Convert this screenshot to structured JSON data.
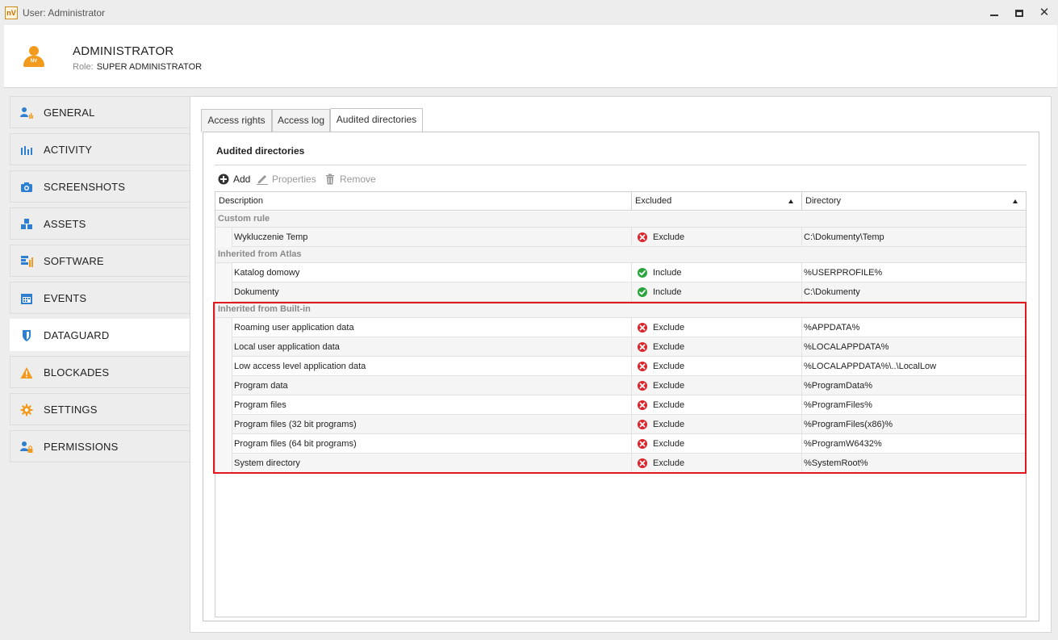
{
  "window": {
    "title": "User: Administrator",
    "app_icon_text": "nV"
  },
  "header": {
    "user_name": "ADMINISTRATOR",
    "role_label": "Role:",
    "role_value": "SUPER ADMINISTRATOR",
    "avatar_text": "NV"
  },
  "sidebar": {
    "items": [
      {
        "label": "GENERAL",
        "icon": "user-chart-icon"
      },
      {
        "label": "ACTIVITY",
        "icon": "bar-chart-icon"
      },
      {
        "label": "SCREENSHOTS",
        "icon": "camera-icon"
      },
      {
        "label": "ASSETS",
        "icon": "cubes-icon"
      },
      {
        "label": "SOFTWARE",
        "icon": "software-icon"
      },
      {
        "label": "EVENTS",
        "icon": "calendar-icon"
      },
      {
        "label": "DATAGUARD",
        "icon": "shield-icon",
        "active": true
      },
      {
        "label": "BLOCKADES",
        "icon": "warning-icon"
      },
      {
        "label": "SETTINGS",
        "icon": "gear-icon"
      },
      {
        "label": "PERMISSIONS",
        "icon": "user-lock-icon"
      }
    ]
  },
  "tabs": [
    {
      "label": "Access rights"
    },
    {
      "label": "Access log"
    },
    {
      "label": "Audited directories",
      "active": true
    }
  ],
  "panel": {
    "title": "Audited directories",
    "toolbar": {
      "add": "Add",
      "properties": "Properties",
      "remove": "Remove"
    },
    "columns": {
      "description": "Description",
      "excluded": "Excluded",
      "directory": "Directory"
    },
    "groups": [
      {
        "label": "Custom rule",
        "rows": [
          {
            "description": "Wykluczenie Temp",
            "status": "Exclude",
            "directory": "C:\\Dokumenty\\Temp"
          }
        ]
      },
      {
        "label": "Inherited from Atlas",
        "rows": [
          {
            "description": "Katalog domowy",
            "status": "Include",
            "directory": "%USERPROFILE%"
          },
          {
            "description": "Dokumenty",
            "status": "Include",
            "directory": "C:\\Dokumenty"
          }
        ]
      },
      {
        "label": "Inherited from Built-in",
        "rows": [
          {
            "description": "Roaming user application data",
            "status": "Exclude",
            "directory": "%APPDATA%"
          },
          {
            "description": "Local user application data",
            "status": "Exclude",
            "directory": "%LOCALAPPDATA%"
          },
          {
            "description": "Low access level application data",
            "status": "Exclude",
            "directory": "%LOCALAPPDATA%\\..\\LocalLow"
          },
          {
            "description": "Program data",
            "status": "Exclude",
            "directory": "%ProgramData%"
          },
          {
            "description": "Program files",
            "status": "Exclude",
            "directory": "%ProgramFiles%"
          },
          {
            "description": "Program files (32 bit programs)",
            "status": "Exclude",
            "directory": "%ProgramFiles(x86)%"
          },
          {
            "description": "Program files (64 bit programs)",
            "status": "Exclude",
            "directory": "%ProgramW6432%"
          },
          {
            "description": "System directory",
            "status": "Exclude",
            "directory": "%SystemRoot%"
          }
        ]
      }
    ]
  },
  "colors": {
    "accent_orange": "#f29a1e",
    "icon_blue": "#2f7fd0",
    "exclude_red": "#d9262b",
    "include_green": "#2aa43c",
    "highlight_red": "#e0191f"
  }
}
